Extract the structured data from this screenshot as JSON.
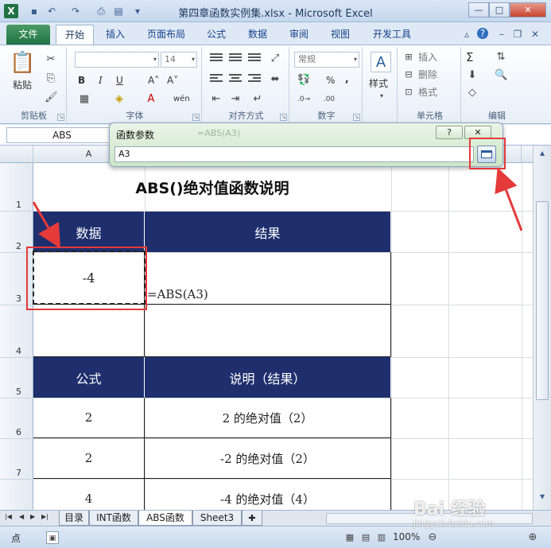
{
  "window": {
    "title": "第四章函数实例集.xlsx - Microsoft Excel",
    "app_icon": "X",
    "controls": {
      "minimize": "—",
      "maximize": "□",
      "close": "✕"
    }
  },
  "ribbon": {
    "tabs": [
      "文件",
      "开始",
      "插入",
      "页面布局",
      "公式",
      "数据",
      "审阅",
      "视图",
      "开发工具"
    ],
    "active_tab": "开始",
    "groups": {
      "clipboard": {
        "label": "剪贴板",
        "paste": "粘贴"
      },
      "font": {
        "label": "字体",
        "font_name": "",
        "font_size": "14",
        "bold": "B",
        "italic": "I",
        "underline": "U",
        "grow": "A˄",
        "shrink": "A˅",
        "phonetic": "wén"
      },
      "alignment": {
        "label": "对齐方式"
      },
      "number": {
        "label": "数字",
        "format": "常规",
        "percent": "%",
        "comma": ","
      },
      "styles": {
        "label": "",
        "styles_button": "样式"
      },
      "cells": {
        "label": "单元格",
        "insert": "插入",
        "delete": "删除",
        "format": "格式"
      },
      "editing": {
        "label": "编辑",
        "sum": "Σ"
      }
    }
  },
  "formula_bar": {
    "name_box": "ABS"
  },
  "dialog": {
    "title": "函数参数",
    "faded_text": "=ABS(A3)",
    "input_value": "A3",
    "help": "?",
    "close": "✕"
  },
  "columns": [
    "A"
  ],
  "rows": [
    "1",
    "2",
    "3",
    "4",
    "5",
    "6",
    "7"
  ],
  "sheet": {
    "title": "ABS()绝对值函数说明",
    "header1": {
      "data": "数据",
      "result": "结果"
    },
    "data_value": "-4",
    "formula_entry": "=ABS(A3)",
    "header2": {
      "formula": "公式",
      "description": "说明（结果）"
    },
    "table": [
      {
        "formula": "2",
        "description": "2 的绝对值（2）"
      },
      {
        "formula": "2",
        "description": "-2 的绝对值（2）"
      },
      {
        "formula": "4",
        "description": "-4 的绝对值（4）"
      }
    ]
  },
  "sheet_tabs": [
    "目录",
    "INT函数",
    "ABS函数",
    "Sheet3"
  ],
  "active_sheet": "ABS函数",
  "status_bar": {
    "mode": "点",
    "zoom": "100%"
  },
  "watermark": {
    "brand": "Bai 经验",
    "url": "jingyan.baidu.com"
  },
  "colors": {
    "header_fill": "#1f2f6e",
    "annotation_red": "#e53a3a",
    "dialog_green": "#cde6c6",
    "file_tab": "#217346"
  }
}
